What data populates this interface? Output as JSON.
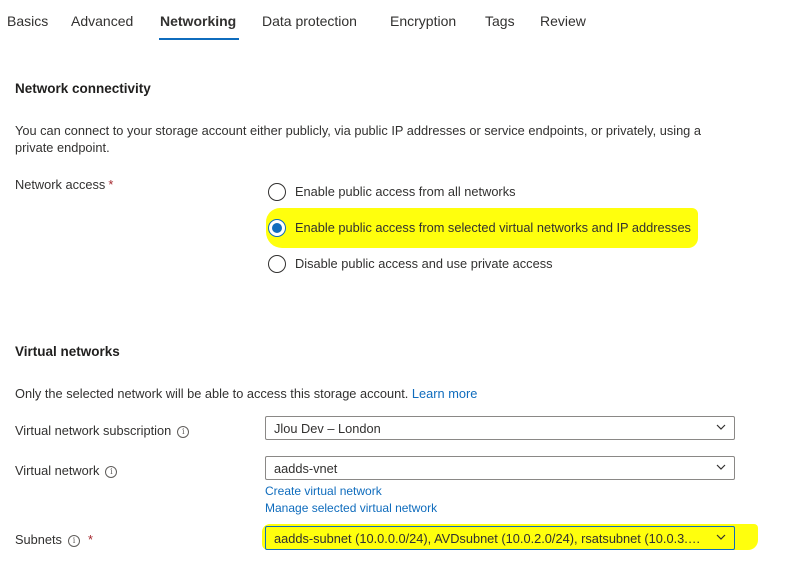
{
  "tabs": [
    {
      "label": "Basics",
      "active": false
    },
    {
      "label": "Advanced",
      "active": false
    },
    {
      "label": "Networking",
      "active": true
    },
    {
      "label": "Data protection",
      "active": false
    },
    {
      "label": "Encryption",
      "active": false
    },
    {
      "label": "Tags",
      "active": false
    },
    {
      "label": "Review",
      "active": false
    }
  ],
  "network_connectivity": {
    "title": "Network connectivity",
    "description": "You can connect to your storage account either publicly, via public IP addresses or service endpoints, or privately, using a private endpoint.",
    "network_access_label": "Network access",
    "required_marker": "*",
    "options": [
      {
        "label": "Enable public access from all networks",
        "checked": false
      },
      {
        "label": "Enable public access from selected virtual networks and IP addresses",
        "checked": true
      },
      {
        "label": "Disable public access and use private access",
        "checked": false
      }
    ]
  },
  "virtual_networks": {
    "title": "Virtual networks",
    "description": "Only the selected network will be able to access this storage account.",
    "learn_more": "Learn more",
    "subscription_label": "Virtual network subscription",
    "subscription_value": "Jlou Dev – London",
    "vnet_label": "Virtual network",
    "vnet_value": "aadds-vnet",
    "create_vnet_link": "Create virtual network",
    "manage_vnet_link": "Manage selected virtual network",
    "subnets_label": "Subnets",
    "required_marker": "*",
    "subnets_value": "aadds-subnet (10.0.0.0/24), AVDsubnet (10.0.2.0/24), rsatsubnet (10.0.3.0/..."
  },
  "colors": {
    "accent": "#0f6cbd",
    "highlight": "#ffff00",
    "required": "#a4262c"
  },
  "icons": {
    "info": "info-icon",
    "chevron": "chevron-down-icon"
  }
}
